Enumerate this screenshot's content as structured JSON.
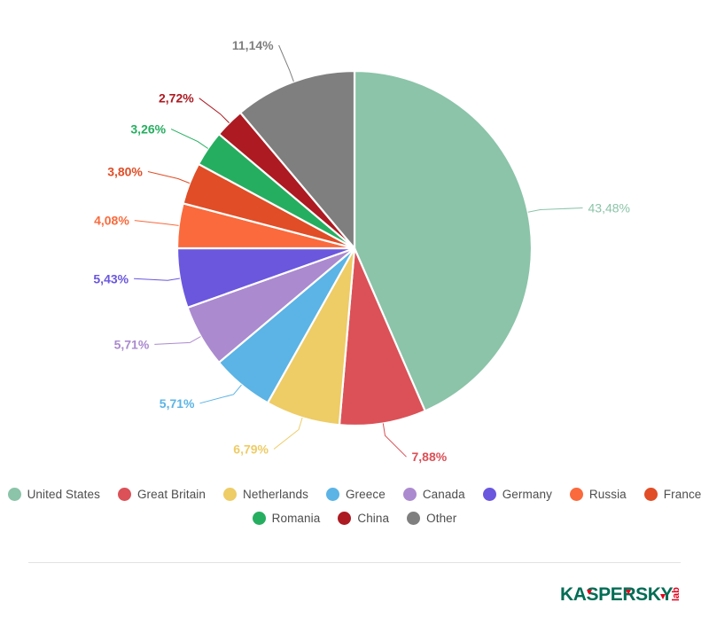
{
  "chart_data": {
    "type": "pie",
    "title": "",
    "categories": [
      "United States",
      "Great Britain",
      "Netherlands",
      "Greece",
      "Canada",
      "Germany",
      "Russia",
      "France",
      "Romania",
      "China",
      "Other"
    ],
    "values": [
      43.48,
      7.88,
      6.79,
      5.71,
      5.71,
      5.43,
      4.08,
      3.8,
      3.26,
      2.72,
      11.14
    ],
    "value_labels": [
      "43,48%",
      "7,88%",
      "6,79%",
      "5,71%",
      "5,71%",
      "5,43%",
      "4,08%",
      "3,80%",
      "3,26%",
      "2,72%",
      "11,14%"
    ],
    "unit": "%",
    "legend_position": "bottom",
    "start_angle_deg": 0,
    "direction": "clockwise",
    "colors": [
      "#8bc4a8",
      "#db5157",
      "#eecc66",
      "#5bb4e5",
      "#ab8acf",
      "#6a57de",
      "#fa6a3c",
      "#e04d26",
      "#26ae60",
      "#ad1a22",
      "#7f7f7f"
    ]
  },
  "legend": {
    "rows": [
      [
        {
          "label": "United States",
          "color": "#8bc4a8"
        },
        {
          "label": "Great Britain",
          "color": "#db5157"
        },
        {
          "label": "Netherlands",
          "color": "#eecc66"
        },
        {
          "label": "Greece",
          "color": "#5bb4e5"
        },
        {
          "label": "Canada",
          "color": "#ab8acf"
        },
        {
          "label": "Germany",
          "color": "#6a57de"
        },
        {
          "label": "Russia",
          "color": "#fa6a3c"
        },
        {
          "label": "France",
          "color": "#e04d26"
        }
      ],
      [
        {
          "label": "Romania",
          "color": "#26ae60"
        },
        {
          "label": "China",
          "color": "#ad1a22"
        },
        {
          "label": "Other",
          "color": "#7f7f7f"
        }
      ]
    ]
  },
  "branding": {
    "logo_name": "kaspersky-lab-logo",
    "wordmark": "KASPERSKY",
    "suffix": "lab",
    "wordmark_color": "#006d55",
    "accent_color": "#e3001b"
  }
}
